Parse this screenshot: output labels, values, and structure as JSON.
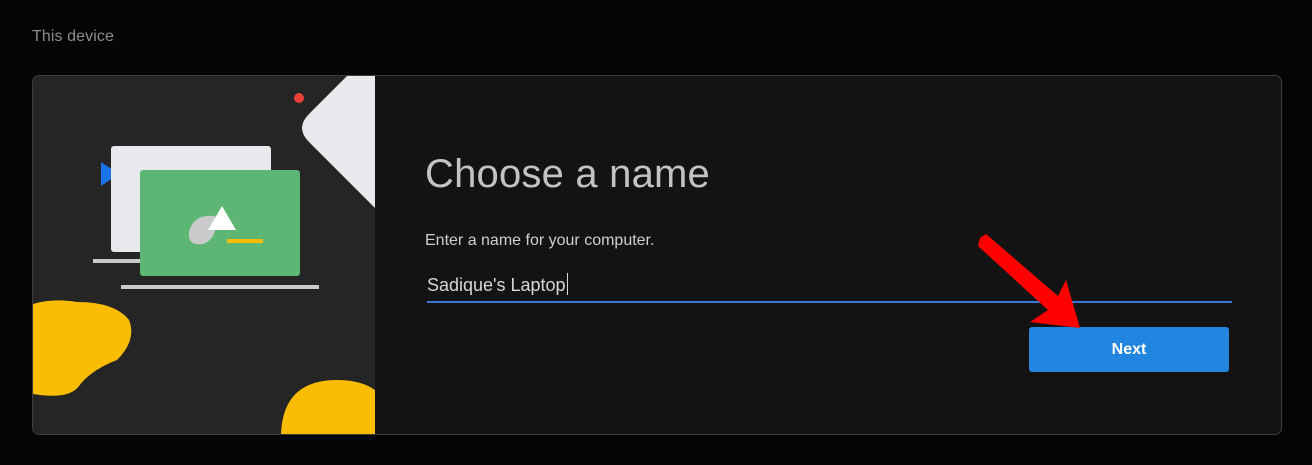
{
  "section": {
    "label": "This device"
  },
  "dialog": {
    "title": "Choose a name",
    "instructions": "Enter a name for your computer.",
    "name_input": {
      "value": "Sadique's Laptop"
    },
    "next_label": "Next"
  },
  "colors": {
    "page_background": "#050505",
    "card_background": "#131313",
    "illustration_background": "#252525",
    "input_underline": "#3b78d8",
    "button_blue": "#2285e0",
    "illustration_green": "#5db673",
    "illustration_yellow": "#fbbc04",
    "illustration_red_dot": "#ea4335",
    "illustration_blue_triangle": "#1a73e8",
    "annotation_arrow": "#ff0000"
  }
}
